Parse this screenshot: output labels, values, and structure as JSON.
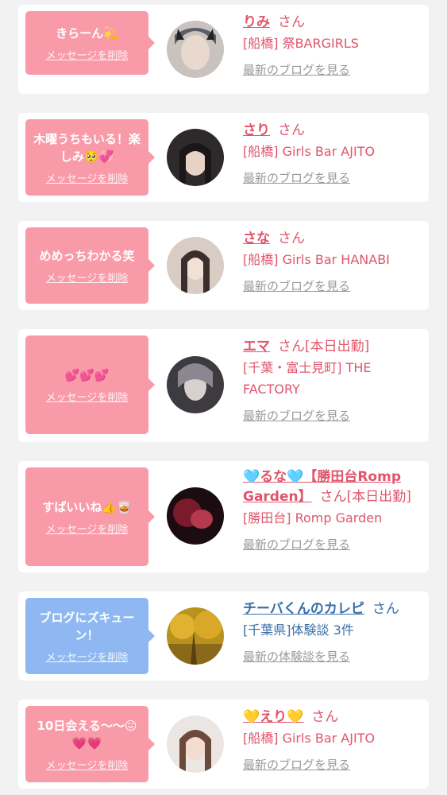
{
  "cards": [
    {
      "message": "きらーん💫",
      "delete": "メッセージを削除",
      "name": "りみ",
      "san": "さん",
      "status": "",
      "store": "[船橋] 祭BARGIRLS",
      "blog": "最新のブログを見る",
      "avatar_color": "#5b5e68"
    },
    {
      "message": "木曜うちもいる！楽しみ🥺💞",
      "delete": "メッセージを削除",
      "name": "さり",
      "san": "さん",
      "status": "",
      "store": "[船橋] Girls Bar AJITO",
      "blog": "最新のブログを見る",
      "avatar_color": "#2e2a2c"
    },
    {
      "message": "めめっちわかる笑",
      "delete": "メッセージを削除",
      "name": "さな",
      "san": "さん",
      "status": "",
      "store": "[船橋] Girls Bar HANABI",
      "blog": "最新のブログを見る",
      "avatar_color": "#d9ccc4"
    },
    {
      "message": "💕💕💕",
      "delete": "メッセージを削除",
      "name": "エマ",
      "san": "さん",
      "status": "[本日出勤]",
      "store": "[千葉・富士見町] THE FACTORY",
      "blog": "最新のブログを見る",
      "avatar_color": "#3d3b40"
    },
    {
      "message": "すぱいいね👍🥃",
      "delete": "メッセージを削除",
      "name": "🩵るな🩵【勝田台Romp Garden】",
      "san": "さん",
      "status": "[本日出勤]",
      "store": "[勝田台] Romp Garden",
      "blog": "最新のブログを見る",
      "avatar_color": "#7a1a2a"
    },
    {
      "message": "ブログにズキューン！",
      "delete": "メッセージを削除",
      "name": "チーバくんのカレピ",
      "san": "さん",
      "status": "",
      "store": "[千葉県]体験談 3件",
      "blog": "最新の体験談を見る",
      "avatar_color": "#b8911f"
    },
    {
      "message": "10日会える〜〜😖💗💗",
      "delete": "メッセージを削除",
      "name": "💛えり💛",
      "san": "さん",
      "status": "",
      "store": "[船橋] Girls Bar AJITO",
      "blog": "最新のブログを見る",
      "avatar_color": "#cdbbb0"
    }
  ]
}
